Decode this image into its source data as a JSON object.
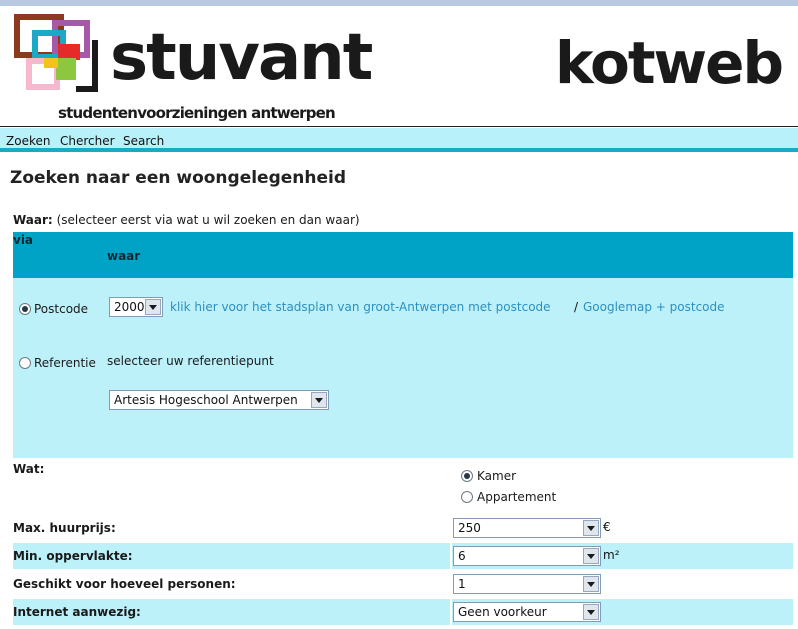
{
  "header": {
    "brand_name": "stuvant",
    "brand_subtitle": "studentenvoorzieningen antwerpen",
    "site_name": "kotweb"
  },
  "nav": {
    "items": [
      "Zoeken",
      "Chercher",
      "Search"
    ]
  },
  "page": {
    "title": "Zoeken naar een woongelegenheid"
  },
  "waar": {
    "label": "Waar:",
    "hint": "(selecteer eerst via wat u wil zoeken en dan waar)",
    "col_via": "via",
    "col_waar": "waar"
  },
  "postcode": {
    "label": "Postcode",
    "selected": true,
    "select_value": "2000",
    "link_stadsplan": "klik hier voor het stadsplan van groot-Antwerpen met postcode",
    "separator": "/",
    "link_googlemap": "Googlemap + postcode"
  },
  "referentie": {
    "label": "Referentie",
    "selected": false,
    "prompt": "selecteer uw referentiepunt",
    "select_value": "Artesis Hogeschool Antwerpen"
  },
  "wat": {
    "label": "Wat:",
    "options": [
      {
        "label": "Kamer",
        "selected": true
      },
      {
        "label": "Appartement",
        "selected": false
      }
    ]
  },
  "filters": {
    "max_huurprijs": {
      "label": "Max. huurprijs:",
      "value": "250",
      "unit": "€"
    },
    "min_oppervlakte": {
      "label": "Min. oppervlakte:",
      "value": "6",
      "unit": "m²"
    },
    "personen": {
      "label": "Geschikt voor hoeveel personen:",
      "value": "1"
    },
    "internet": {
      "label": "Internet aanwezig:",
      "value": "Geen voorkeur"
    }
  },
  "colors": {
    "accent": "#1aaac8",
    "band_dark": "#00a2c6",
    "band_light": "#bdf1fa",
    "link": "#2d8fbf"
  }
}
